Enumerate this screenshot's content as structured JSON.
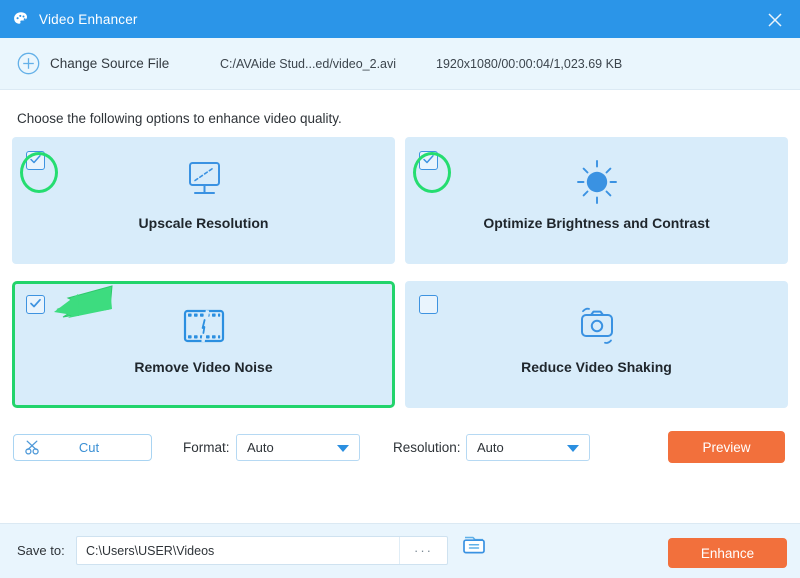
{
  "window": {
    "title": "Video Enhancer",
    "title_icon": "palette-icon",
    "close_icon": "close-icon",
    "accent_blue": "#2b95e8",
    "accent_orange": "#f2703c",
    "highlight_green": "#22d46b",
    "card_bg": "#d8ecfa"
  },
  "source_bar": {
    "plus_icon": "plus-circle-icon",
    "change_source_label": "Change Source File",
    "file_path": "C:/AVAide Stud...ed/video_2.avi",
    "file_meta": "1920x1080/00:00:04/1,023.69 KB"
  },
  "main": {
    "instructions": "Choose the following options to enhance video quality.",
    "options": [
      {
        "label": "Upscale Resolution",
        "icon": "monitor-upscale-icon",
        "checked": true,
        "highlighted_circle": true,
        "highlighted_card": false
      },
      {
        "label": "Optimize Brightness and Contrast",
        "icon": "sun-brightness-icon",
        "checked": true,
        "highlighted_circle": true,
        "highlighted_card": false
      },
      {
        "label": "Remove Video Noise",
        "icon": "film-strip-icon",
        "checked": true,
        "highlighted_circle": false,
        "highlighted_card": true
      },
      {
        "label": "Reduce Video Shaking",
        "icon": "camera-shake-icon",
        "checked": false,
        "highlighted_circle": false,
        "highlighted_card": false
      }
    ]
  },
  "controls": {
    "cut_label": "Cut",
    "cut_icon": "scissors-icon",
    "format_label": "Format:",
    "format_value": "Auto",
    "resolution_label": "Resolution:",
    "resolution_value": "Auto",
    "preview_label": "Preview",
    "caret_icon": "chevron-down-icon"
  },
  "bottom_bar": {
    "save_to_label": "Save to:",
    "save_path": "C:\\Users\\USER\\Videos",
    "browse_label": "···",
    "folder_icon": "open-folder-icon",
    "enhance_label": "Enhance"
  }
}
